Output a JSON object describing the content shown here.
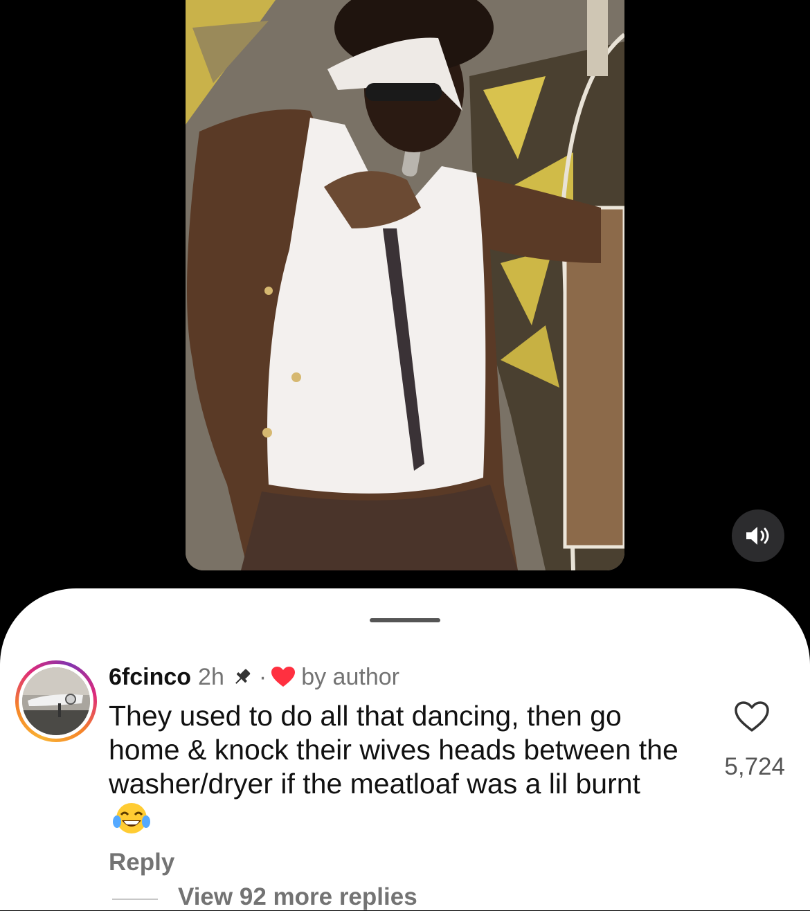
{
  "video": {
    "mute_icon": "speaker-sound-icon"
  },
  "comment": {
    "username": "6fcinco",
    "time": "2h",
    "pinned_icon": "pin-icon",
    "separator": "·",
    "author_badge_icon": "red-heart-icon",
    "author_like_label": "by author",
    "text": "They used to do all that dancing, then go home & knock their wives heads between the washer/dryer if the meatloaf was a lil burnt",
    "emoji": "face-with-tears-of-joy",
    "reply_label": "Reply",
    "view_replies_label": "View 92 more replies",
    "like_icon": "heart-outline-icon",
    "like_count": "5,724"
  },
  "colors": {
    "background": "#000000",
    "sheet": "#ffffff",
    "secondary_text": "#737373",
    "heart_red": "#ff3040"
  }
}
